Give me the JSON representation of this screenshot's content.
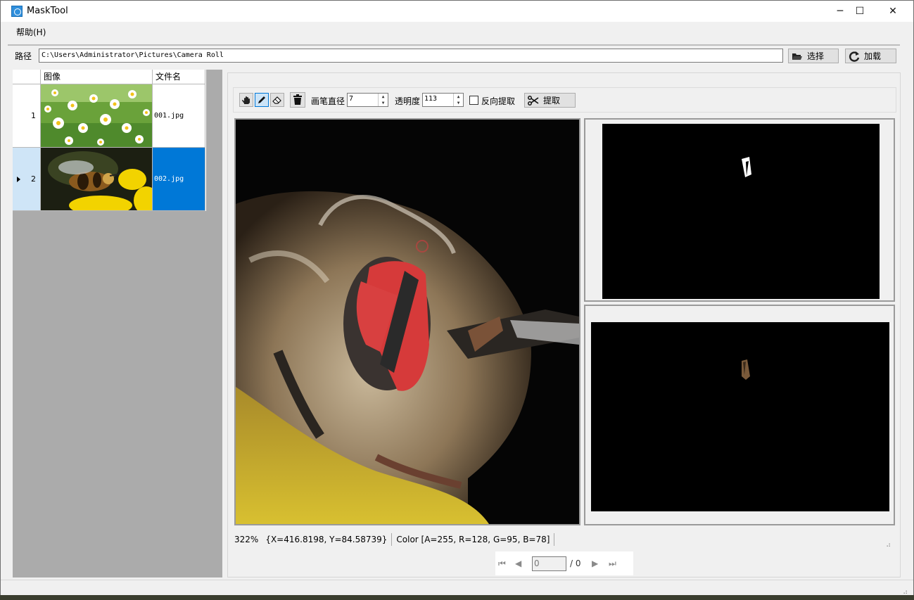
{
  "window": {
    "title": "MaskTool",
    "minimize_glyph": "─",
    "maximize_glyph": "☐",
    "close_glyph": "✕"
  },
  "menu": {
    "help": "帮助(H)"
  },
  "pathbar": {
    "label": "路径",
    "value": "C:\\Users\\Administrator\\Pictures\\Camera Roll",
    "select_button": "选择",
    "load_button": "加载"
  },
  "grid": {
    "columns": [
      "",
      "图像",
      "文件名"
    ],
    "rows": [
      {
        "index": "1",
        "file": "001.jpg",
        "selected": false
      },
      {
        "index": "2",
        "file": "002.jpg",
        "selected": true
      }
    ]
  },
  "toolbar": {
    "brush_size_label": "画笔直径",
    "brush_size_value": "7",
    "opacity_label": "透明度",
    "opacity_value": "113",
    "invert_label": "反向提取",
    "invert_checked": false,
    "extract_button": "提取"
  },
  "status": {
    "zoom": "322%",
    "coords": "{X=416.8198, Y=84.58739}",
    "color": "Color [A=255, R=128, G=95, B=78]"
  },
  "pager": {
    "current": "0",
    "total": "/ 0"
  },
  "colors": {
    "accent": "#0078d7",
    "mask_red": "#d63a3a",
    "canvas_bg": "#000000"
  }
}
